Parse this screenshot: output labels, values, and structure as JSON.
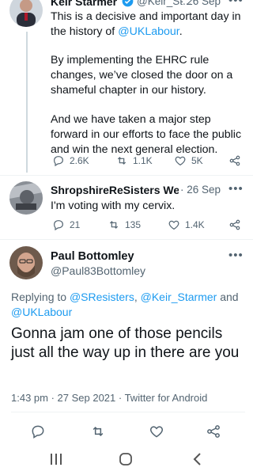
{
  "tweet1": {
    "author_name": "Keir Starmer",
    "handle": "@Keir_St...",
    "time": "· 26 Sep",
    "paragraph1_a": "This is a decisive and important day in the",
    "paragraph1_b": "history of",
    "paragraph1_mention": "@UKLabour",
    "paragraph1_c": ".",
    "paragraph2": "By implementing the EHRC rule changes, we’ve closed the door on a shameful chapter in our history.",
    "paragraph3": "And we have taken a major step forward in our efforts to face the public and win the next general election.",
    "replies": "2.6K",
    "retweets": "1.1K",
    "likes": "5K"
  },
  "tweet2": {
    "author_name": "ShropshireReSisters Wendy",
    "time": "· 26 Sep",
    "text": "I'm voting with my cervix.",
    "replies": "21",
    "retweets": "135",
    "likes": "1.4K"
  },
  "focus_tweet": {
    "author_name": "Paul Bottomley",
    "handle": "@Paul83Bottomley",
    "replying_prefix": "Replying to",
    "replying_mention1": "@SResisters",
    "replying_sep": ",",
    "replying_mention2": "@Keir_Starmer",
    "replying_and": "and",
    "replying_mention3": "@UKLabour",
    "text": "Gonna jam one of those pencils just all the way up in there are you",
    "meta": "1:43 pm · 27 Sep 2021 · Twitter for Android"
  },
  "icons": {
    "verified": "verified-badge-icon",
    "more": "more-options-icon",
    "reply": "reply-icon",
    "retweet": "retweet-icon",
    "like": "heart-icon",
    "share": "share-icon",
    "nav_recents": "recents-icon",
    "nav_home": "home-icon",
    "nav_back": "back-icon"
  },
  "colors": {
    "accent": "#1d9bf0",
    "muted": "#536471",
    "text": "#0f1419"
  }
}
